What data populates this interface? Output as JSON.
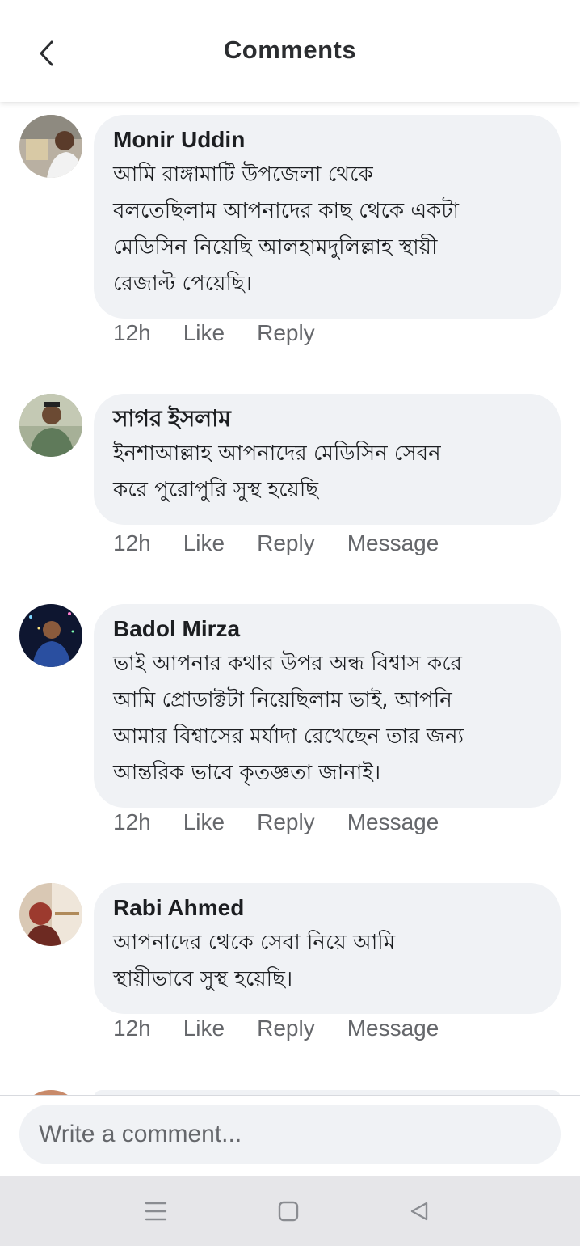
{
  "header": {
    "title": "Comments",
    "back_icon": "chevron-left-icon"
  },
  "comments": [
    {
      "author": "Monir Uddin",
      "text": "আমি রাঙ্গামাটি উপজেলা থেকে\nবলতেছিলাম আপনাদের কাছ থেকে একটা\nমেডিসিন নিয়েছি আলহামদুলিল্লাহ স্থায়ী\nরেজাল্ট পেয়েছি।",
      "time": "12h",
      "like": "Like",
      "reply": "Reply"
    },
    {
      "author": "সাগর ইসলাম",
      "text": "ইনশাআল্লাহ আপনাদের মেডিসিন সেবন\nকরে পুরোপুরি সুস্থ হয়েছি",
      "time": "12h",
      "like": "Like",
      "reply": "Reply",
      "message": "Message"
    },
    {
      "author": "Badol Mirza",
      "text": "ভাই আপনার কথার উপর অন্ধ বিশ্বাস করে\nআমি প্রোডাক্টটা নিয়েছিলাম ভাই, আপনি\nআমার বিশ্বাসের মর্যাদা রেখেছেন তার জন্য\nআন্তরিক ভাবে কৃতজ্ঞতা জানাই।",
      "time": "12h",
      "like": "Like",
      "reply": "Reply",
      "message": "Message"
    },
    {
      "author": "Rabi Ahmed",
      "text": "আপনাদের থেকে সেবা নিয়ে আমি\nস্থায়ীভাবে সুস্থ হয়েছি।",
      "time": "12h",
      "like": "Like",
      "reply": "Reply",
      "message": "Message"
    }
  ],
  "composer": {
    "placeholder": "Write a comment..."
  },
  "navbar": {
    "menu_icon": "menu-icon",
    "home_icon": "home-square-icon",
    "back_icon": "back-triangle-icon"
  },
  "colors": {
    "bubble": "#f0f2f5",
    "meta_text": "#65676b",
    "navbar": "#e6e6e9"
  }
}
